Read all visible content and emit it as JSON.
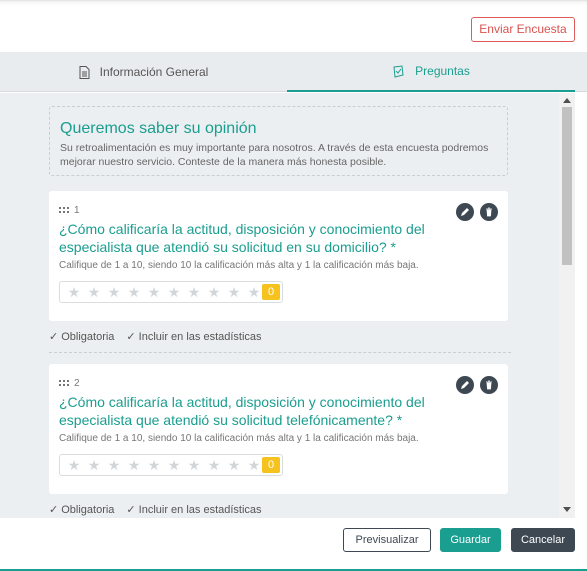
{
  "header": {
    "send_label": "Enviar Encuesta"
  },
  "tabs": [
    {
      "label": "Información General",
      "icon": "document-icon",
      "active": false
    },
    {
      "label": "Preguntas",
      "icon": "survey-icon",
      "active": true
    }
  ],
  "intro": {
    "title": "Queremos saber su opinión",
    "text": "Su retroalimentación es muy importante para nosotros. A través de esta encuesta podremos mejorar nuestro servicio. Conteste de la manera más honesta posible."
  },
  "questions": [
    {
      "number": "1",
      "title": "¿Cómo calificaría la actitud, disposición y conocimiento del especialista que atendió su solicitud en su domicilio? *",
      "hint": "Califique de 1 a 10, siendo 10 la calificación más alta y 1 la calificación más baja.",
      "rating_value": "0",
      "rating_max": 10,
      "options": [
        "Obligatoria",
        "Incluir en las estadísticas"
      ]
    },
    {
      "number": "2",
      "title": "¿Cómo calificaría la actitud, disposición y conocimiento del especialista que atendió su solicitud telefónicamente? *",
      "hint": "Califique de 1 a 10, siendo 10 la calificación más alta y 1 la calificación más baja.",
      "rating_value": "0",
      "rating_max": 10,
      "options": [
        "Obligatoria",
        "Incluir en las estadísticas"
      ]
    }
  ],
  "footer": {
    "preview_label": "Previsualizar",
    "save_label": "Guardar",
    "cancel_label": "Cancelar"
  },
  "colors": {
    "accent": "#1a9e8f",
    "danger": "#d9534f",
    "dark": "#3d4852",
    "star_score": "#f6c21e"
  }
}
